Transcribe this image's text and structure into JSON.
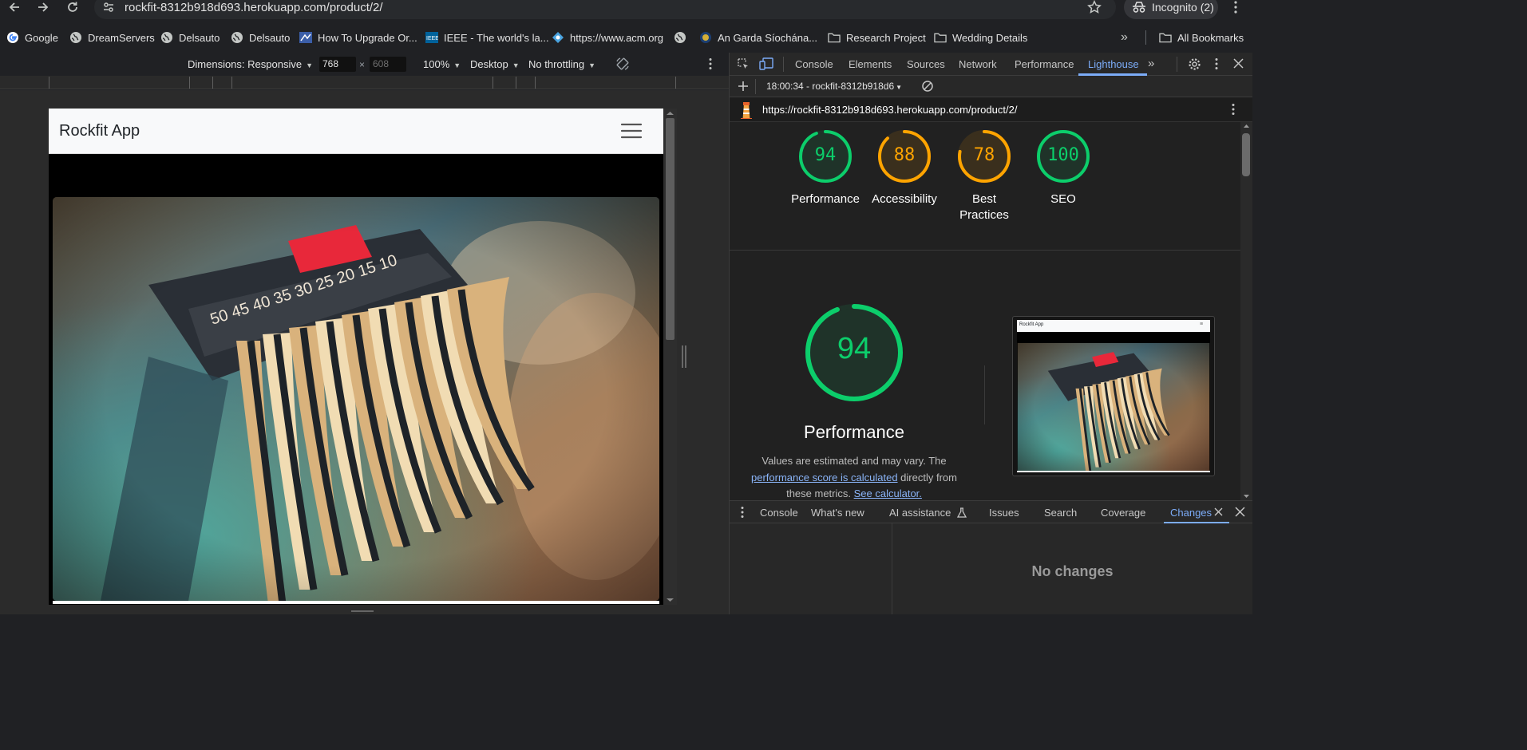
{
  "browser": {
    "url": "rockfit-8312b918d693.herokuapp.com/product/2/",
    "incognito_label": "Incognito (2)",
    "bookmarks": [
      {
        "label": "Google",
        "icon": "google-icon"
      },
      {
        "label": "DreamServers",
        "icon": "globe-icon"
      },
      {
        "label": "Delsauto",
        "icon": "globe-icon"
      },
      {
        "label": "Delsauto",
        "icon": "globe-icon"
      },
      {
        "label": "How To Upgrade Or...",
        "icon": "site-icon"
      },
      {
        "label": "IEEE - The world's la...",
        "icon": "ieee-icon"
      },
      {
        "label": "https://www.acm.org",
        "icon": "acm-icon"
      },
      {
        "label": "",
        "icon": "globe-icon"
      },
      {
        "label": "An Garda Síochána...",
        "icon": "garda-icon"
      },
      {
        "label": "Research Project",
        "icon": "folder-icon"
      },
      {
        "label": "Wedding Details",
        "icon": "folder-icon"
      }
    ],
    "all_bookmarks_label": "All Bookmarks"
  },
  "device_toolbar": {
    "dimensions_label": "Dimensions: Responsive",
    "width": "768",
    "height": "608",
    "zoom": "100%",
    "device_type": "Desktop",
    "throttling": "No throttling"
  },
  "site": {
    "brand": "Rockfit App"
  },
  "devtools": {
    "tabs": [
      "Console",
      "Elements",
      "Sources",
      "Network",
      "Performance",
      "Lighthouse"
    ],
    "active_tab": "Lighthouse",
    "report_selector": "18:00:34 - rockfit-8312b918d6",
    "report_url": "https://rockfit-8312b918d693.herokuapp.com/product/2/",
    "scores": [
      {
        "label": "Performance",
        "value": 94,
        "color": "#0cce6b"
      },
      {
        "label": "Accessibility",
        "value": 88,
        "color": "#ffa400"
      },
      {
        "label": "Best Practices",
        "value": 78,
        "color": "#ffa400"
      },
      {
        "label": "SEO",
        "value": 100,
        "color": "#0cce6b"
      }
    ],
    "main_score": {
      "label": "Performance",
      "value": 94,
      "color": "#0cce6b"
    },
    "description": {
      "part1": "Values are estimated and may vary. The",
      "link1": "performance score is calculated",
      "part2": "directly from these metrics.",
      "link2": "See calculator."
    },
    "thumb_brand": "Rockfit App",
    "drawer_tabs": [
      "Console",
      "What's new",
      "AI assistance",
      "Issues",
      "Search",
      "Coverage",
      "Changes"
    ],
    "active_drawer_tab": "Changes",
    "no_changes": "No changes"
  }
}
